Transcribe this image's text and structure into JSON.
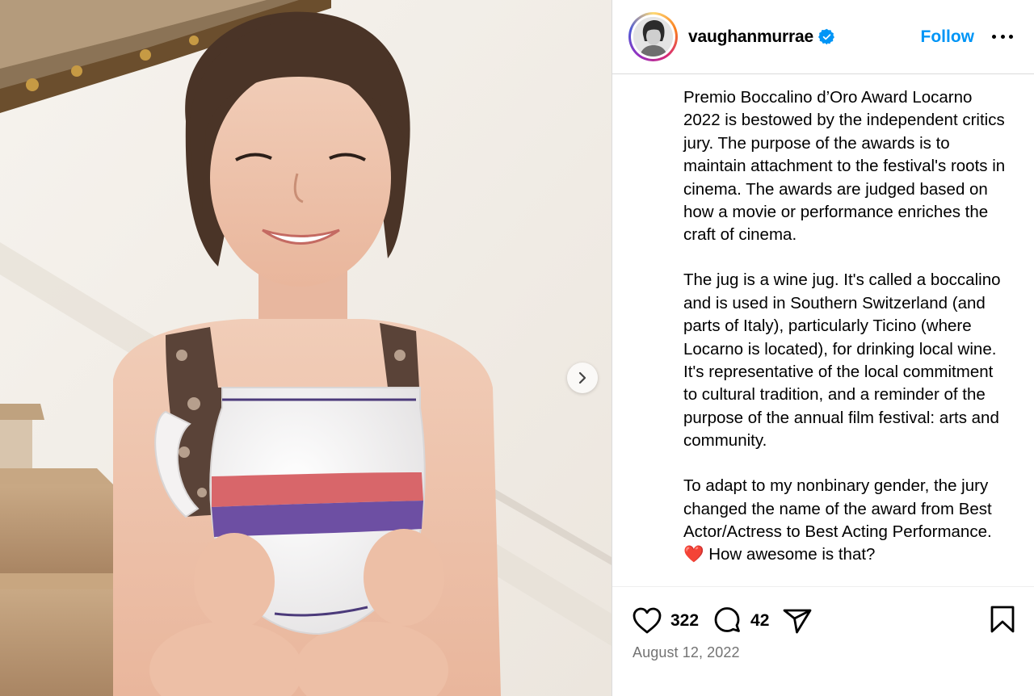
{
  "post": {
    "username": "vaughanmurrae",
    "verified": true,
    "follow_label": "Follow",
    "caption_paragraphs": [
      "Premio Boccalino d’Oro Award Locarno 2022 is bestowed by the independent critics jury. The purpose of the awards is to maintain attachment to the festival's roots in cinema. The awards are judged based on how a movie or performance enriches the craft of cinema.",
      "The jug is a wine jug. It's called a boccalino and is used in Southern Switzerland (and parts of Italy), particularly Ticino (where Locarno is located), for drinking local wine. It's representative of the local commitment to cultural tradition, and a reminder of the purpose of the annual film festival: arts and community.",
      "To adapt to my nonbinary gender, the jury changed the name of the award from Best Actor/Actress to Best Acting Performance. ❤️ How awesome is that?"
    ],
    "likes": "322",
    "comments": "42",
    "date": "August 12, 2022"
  },
  "icons": {
    "verified": "verified-badge-icon",
    "more": "more-options-icon",
    "like": "heart-icon",
    "comment": "comment-icon",
    "share": "paper-plane-icon",
    "save": "bookmark-icon",
    "next": "chevron-right-icon"
  },
  "colors": {
    "accent": "#0095f6",
    "border": "#dbdbdb",
    "muted_text": "#737373"
  }
}
